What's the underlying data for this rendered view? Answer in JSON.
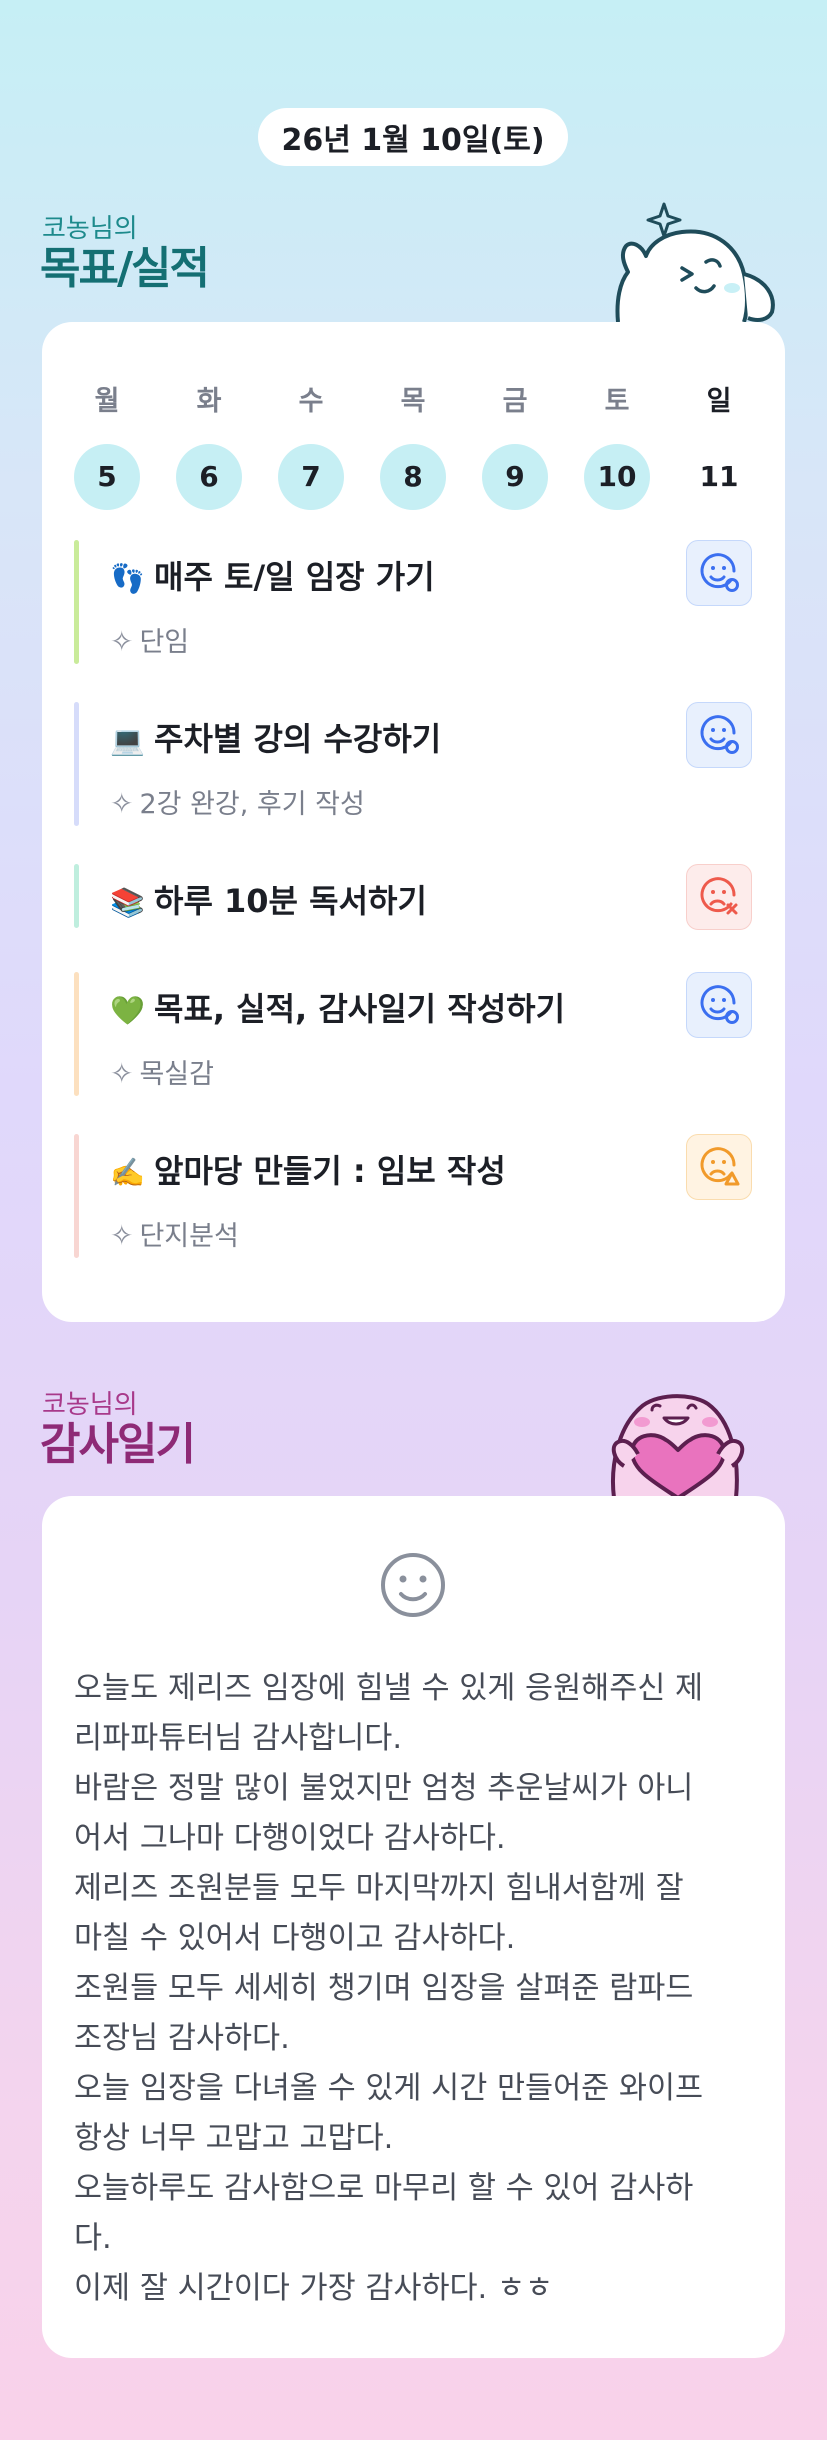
{
  "header": {
    "date": "26년 1월 10일(토)"
  },
  "goals_section": {
    "subtitle": "코농님의",
    "title": "목표/실적",
    "week": [
      {
        "label": "월",
        "date": "5",
        "highlight": true
      },
      {
        "label": "화",
        "date": "6",
        "highlight": true
      },
      {
        "label": "수",
        "date": "7",
        "highlight": true
      },
      {
        "label": "목",
        "date": "8",
        "highlight": true
      },
      {
        "label": "금",
        "date": "9",
        "highlight": true
      },
      {
        "label": "토",
        "date": "10",
        "highlight": true
      },
      {
        "label": "일",
        "date": "11",
        "highlight": false
      }
    ],
    "items": [
      {
        "emoji": "👣",
        "title": "매주 토/일 임장 가기",
        "note": "단임",
        "status": "done",
        "bar_color": "#c9eb9a"
      },
      {
        "emoji": "💻",
        "title": "주차별 강의 수강하기",
        "note": "2강 완강, 후기 작성",
        "status": "done",
        "bar_color": "#d6dcfa"
      },
      {
        "emoji": "📚",
        "title": "하루 10분 독서하기",
        "note": "",
        "status": "fail",
        "bar_color": "#bfeede"
      },
      {
        "emoji": "💚",
        "title": "목표, 실적, 감사일기 작성하기",
        "note": "목실감",
        "status": "done",
        "bar_color": "#fce0bf"
      },
      {
        "emoji": "✍️",
        "title": "앞마당 만들기 : 임보 작성",
        "note": "단지분석",
        "status": "partial",
        "bar_color": "#f8d6d2"
      }
    ],
    "colors": {
      "done": "#3b6ff0",
      "fail": "#ee5a4c",
      "partial": "#f19a2a",
      "day_highlight": "#c6eff4"
    }
  },
  "gratitude_section": {
    "subtitle": "코농님의",
    "title": "감사일기",
    "mood_icon": "neutral-smiley-icon",
    "lines": [
      "오늘도 제리즈 임장에 힘낼 수 있게 응원해주신 제",
      "리파파튜터님 감사합니다.",
      "바람은 정말 많이 불었지만 엄청 추운날씨가 아니",
      "어서 그나마 다행이었다 감사하다.",
      "제리즈 조원분들 모두 마지막까지 힘내서함께 잘",
      "마칠 수 있어서 다행이고 감사하다.",
      "조원들 모두 세세히 챙기며 임장을 살펴준 람파드",
      "조장님 감사하다.",
      "오늘 임장을 다녀올 수 있게 시간 만들어준 와이프",
      "항상 너무 고맙고 고맙다.",
      "오늘하루도 감사함으로 마무리 할 수 있어 감사하",
      "다.",
      "이제 잘 시간이다 가장 감사하다. ㅎㅎ"
    ]
  }
}
